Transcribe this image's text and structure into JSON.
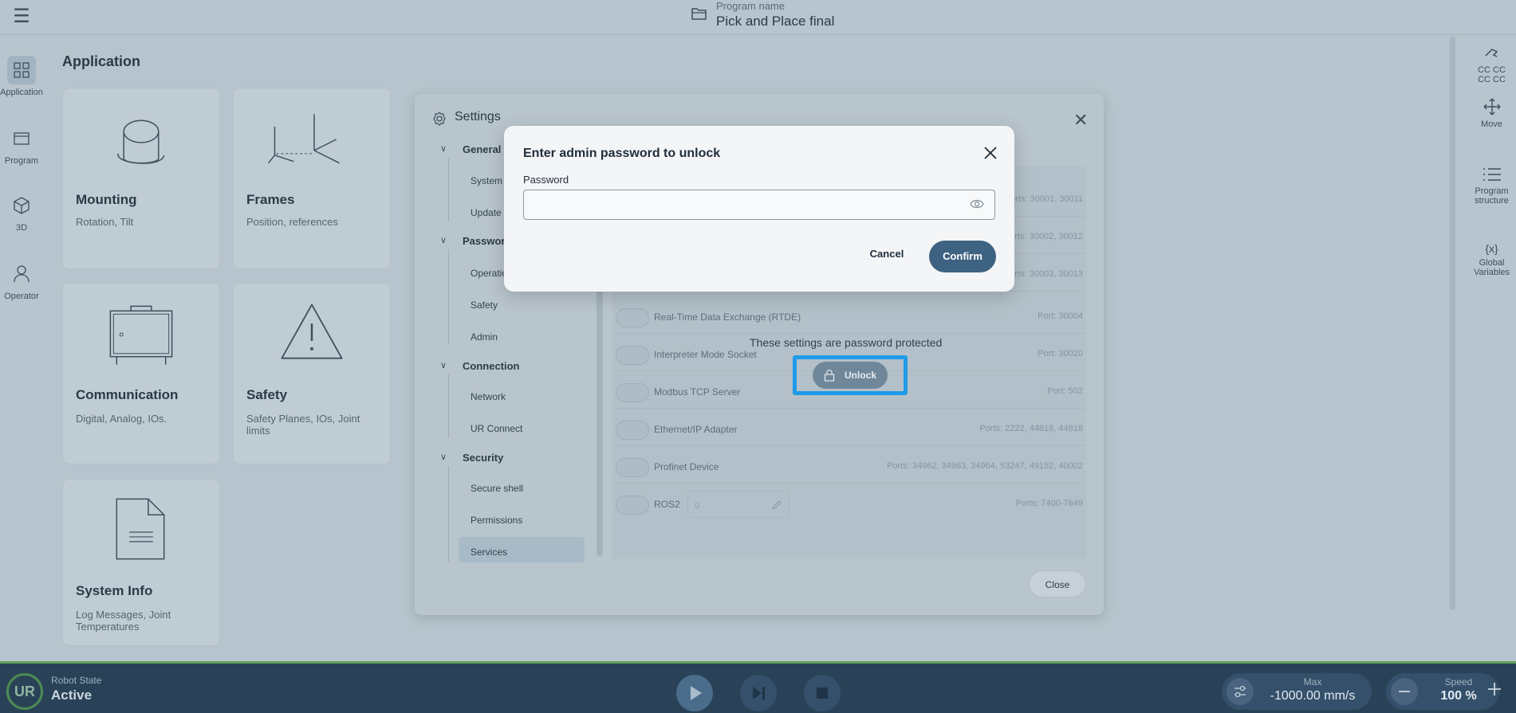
{
  "header": {
    "program_label": "Program name",
    "program_name": "Pick and Place final"
  },
  "left_nav": [
    {
      "label": "Application",
      "icon": "grid-icon"
    },
    {
      "label": "Program",
      "icon": "program-icon"
    },
    {
      "label": "3D",
      "icon": "cube-icon"
    },
    {
      "label": "Operator",
      "icon": "person-icon"
    }
  ],
  "right_nav": {
    "cc_line1": "CC CC",
    "cc_line2": "CC CC",
    "move": "Move",
    "program_structure_1": "Program",
    "program_structure_2": "structure",
    "global_vars_1": "Global",
    "global_vars_2": "Variables",
    "global_vars_icon": "{x}"
  },
  "main": {
    "title": "Application",
    "cards": [
      {
        "title": "Mounting",
        "subtitle": "Rotation, Tilt"
      },
      {
        "title": "Frames",
        "subtitle": "Position, references"
      },
      {
        "title": "Communication",
        "subtitle": "Digital, Analog, IOs."
      },
      {
        "title": "Safety",
        "subtitle": "Safety Planes, IOs, Joint limits"
      },
      {
        "title": "System Info",
        "subtitle": "Log Messages, Joint Temperatures"
      }
    ]
  },
  "settings": {
    "title": "Settings",
    "groups": [
      {
        "label": "General",
        "items": [
          "System",
          "Update"
        ]
      },
      {
        "label": "Password",
        "items": [
          "Operation",
          "Safety",
          "Admin"
        ]
      },
      {
        "label": "Connection",
        "items": [
          "Network",
          "UR Connect"
        ]
      },
      {
        "label": "Security",
        "items": [
          "Secure shell",
          "Permissions",
          "Services"
        ]
      }
    ],
    "services": [
      {
        "name": "",
        "port": "Ports: 30001, 30011"
      },
      {
        "name": "",
        "port": "Ports: 30002, 30012"
      },
      {
        "name": "",
        "port": "Ports: 30003, 30013"
      },
      {
        "name": "Real-Time Data Exchange (RTDE)",
        "port": "Port: 30004"
      },
      {
        "name": "Interpreter Mode Socket",
        "port": "Port: 30020"
      },
      {
        "name": "Modbus TCP Server",
        "port": "Port: 502"
      },
      {
        "name": "Ethernet/IP Adapter",
        "port": "Ports: 2222, 44818, 44818"
      },
      {
        "name": "Profinet Device",
        "port": "Ports: 34962, 34963, 34964, 53247, 49152, 40002"
      },
      {
        "name": "ROS2",
        "port": "Ports: 7400-7649",
        "input_value": "0"
      }
    ],
    "protected_text": "These settings are password protected",
    "unlock_label": "Unlock",
    "close_label": "Close"
  },
  "password_dialog": {
    "title": "Enter admin password to unlock",
    "field_label": "Password",
    "field_value": "",
    "cancel_label": "Cancel",
    "confirm_label": "Confirm"
  },
  "footer": {
    "robot_state_label": "Robot State",
    "robot_state_value": "Active",
    "logo_text": "UR",
    "max_label": "Max",
    "max_value": "-1000.00 mm/s",
    "speed_label": "Speed",
    "speed_value": "100 %"
  },
  "colors": {
    "accent": "#3e6281",
    "highlight": "#1f9be8",
    "status_green": "#5ea05b"
  }
}
